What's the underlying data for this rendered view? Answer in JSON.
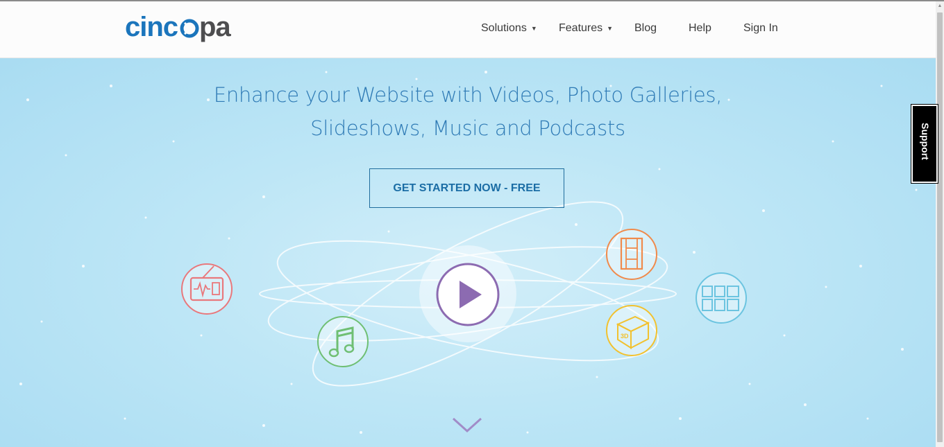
{
  "brand": {
    "logo_text": "cincopa"
  },
  "nav": {
    "items": [
      {
        "label": "Solutions",
        "has_dropdown": true
      },
      {
        "label": "Features",
        "has_dropdown": true
      },
      {
        "label": "Blog",
        "has_dropdown": false
      },
      {
        "label": "Help",
        "has_dropdown": false
      },
      {
        "label": "Sign In",
        "has_dropdown": false
      }
    ],
    "caret": "▼"
  },
  "hero": {
    "headline_line1": "Enhance your Website with Videos, Photo Galleries,",
    "headline_line2": "Slideshows, Music and Podcasts",
    "cta_label": "GET STARTED NOW - FREE",
    "icons": [
      "radio-icon",
      "music-note-icon",
      "play-icon",
      "film-strip-icon",
      "3d-cube-icon",
      "gallery-grid-icon",
      "scroll-down-chevron-icon"
    ],
    "cube_label": "3D"
  },
  "support": {
    "label": "Support"
  },
  "colors": {
    "brand_blue": "#1b75bc",
    "brand_dark": "#4d4d4f",
    "headline": "#2e7ab5",
    "radio": "#e9787c",
    "music": "#6fbf73",
    "play": "#8c6bb1",
    "film": "#f08a4b",
    "cube": "#f2c12e",
    "gallery": "#6cc4e0"
  }
}
